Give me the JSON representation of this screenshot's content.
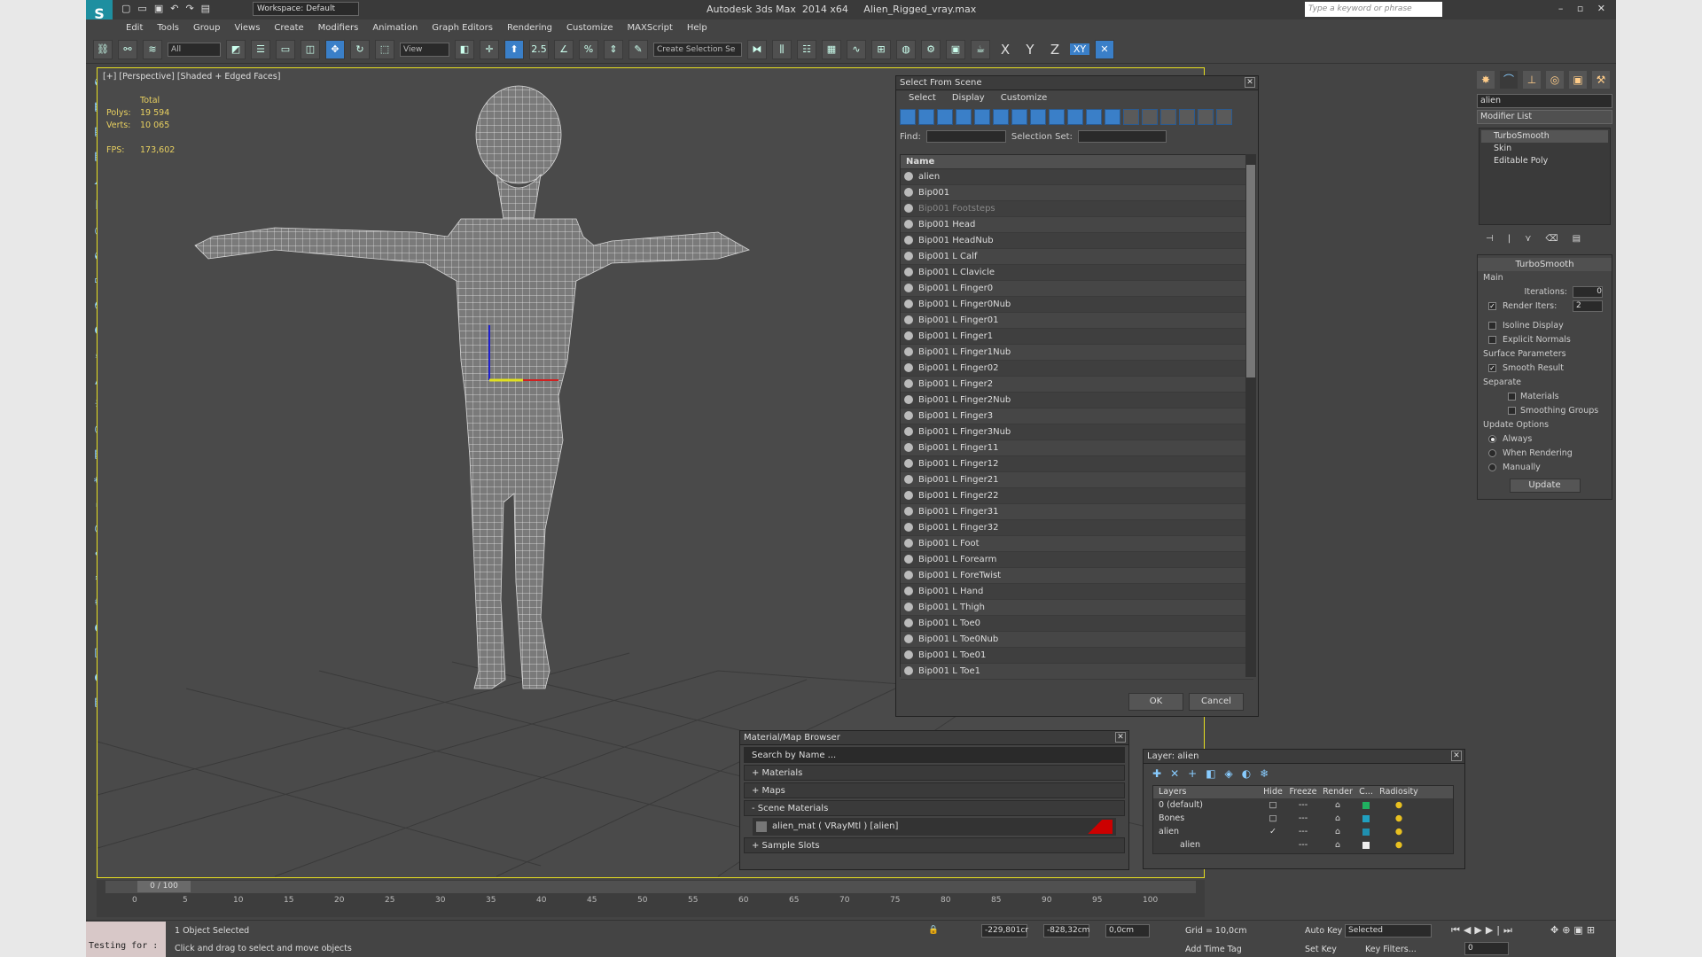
{
  "titlebar": {
    "app_title": "Autodesk 3ds Max  2014 x64     Alien_Rigged_vray.max",
    "workspace": "Workspace: Default",
    "keyword_placeholder": "Type a keyword or phrase"
  },
  "menu": [
    "Edit",
    "Tools",
    "Group",
    "Views",
    "Create",
    "Modifiers",
    "Animation",
    "Graph Editors",
    "Rendering",
    "Customize",
    "MAXScript",
    "Help"
  ],
  "toolbar": {
    "filter": "All",
    "view": "View",
    "snap_angle": "2.5",
    "selection_set": "Create Selection Se",
    "axes": [
      "X",
      "Y",
      "Z",
      "XY"
    ]
  },
  "viewport": {
    "label": "[+] [Perspective] [Shaded + Edged Faces]",
    "stats_total": "Total",
    "polys_label": "Polys:",
    "polys_value": "19 594",
    "verts_label": "Verts:",
    "verts_value": "10 065",
    "fps_label": "FPS:",
    "fps_value": "173,602"
  },
  "select_from_scene": {
    "title": "Select From Scene",
    "menu": [
      "Select",
      "Display",
      "Customize"
    ],
    "find_label": "Find:",
    "selection_set_label": "Selection Set:",
    "column_name": "Name",
    "items": [
      "alien",
      "Bip001",
      "Bip001 Footsteps",
      "Bip001 Head",
      "Bip001 HeadNub",
      "Bip001 L Calf",
      "Bip001 L Clavicle",
      "Bip001 L Finger0",
      "Bip001 L Finger0Nub",
      "Bip001 L Finger01",
      "Bip001 L Finger1",
      "Bip001 L Finger1Nub",
      "Bip001 L Finger02",
      "Bip001 L Finger2",
      "Bip001 L Finger2Nub",
      "Bip001 L Finger3",
      "Bip001 L Finger3Nub",
      "Bip001 L Finger11",
      "Bip001 L Finger12",
      "Bip001 L Finger21",
      "Bip001 L Finger22",
      "Bip001 L Finger31",
      "Bip001 L Finger32",
      "Bip001 L Foot",
      "Bip001 L Forearm",
      "Bip001 L ForeTwist",
      "Bip001 L Hand",
      "Bip001 L Thigh",
      "Bip001 L Toe0",
      "Bip001 L Toe0Nub",
      "Bip001 L Toe01",
      "Bip001 L Toe1"
    ],
    "ok": "OK",
    "cancel": "Cancel"
  },
  "material_browser": {
    "title": "Material/Map Browser",
    "search_placeholder": "Search by Name ...",
    "materials": "+ Materials",
    "maps": "+ Maps",
    "scene_materials": "- Scene Materials",
    "material_item": "alien_mat  ( VRayMtl )  [alien]",
    "sample_slots": "+ Sample Slots"
  },
  "layer_panel": {
    "title": "Layer: alien",
    "headers": [
      "Layers",
      "Hide",
      "Freeze",
      "Render",
      "C...",
      "Radiosity"
    ],
    "rows": [
      "0 (default)",
      "Bones",
      "alien",
      "alien"
    ]
  },
  "command_panel": {
    "object_name": "alien",
    "modifier_list": "Modifier List",
    "stack": [
      "TurboSmooth",
      "Skin",
      "Editable Poly"
    ],
    "turbosmooth_title": "TurboSmooth",
    "main_label": "Main",
    "iterations_label": "Iterations:",
    "iterations_value": "0",
    "render_iters_label": "Render Iters:",
    "render_iters_value": "2",
    "isoline": "Isoline Display",
    "explicit_normals": "Explicit Normals",
    "surface_params": "Surface Parameters",
    "smooth_result": "Smooth Result",
    "separate": "Separate",
    "materials": "Materials",
    "smoothing_groups": "Smoothing Groups",
    "update_options": "Update Options",
    "always": "Always",
    "when_rendering": "When Rendering",
    "manually": "Manually",
    "update_btn": "Update"
  },
  "timeline": {
    "frame": "0 / 100",
    "ticks": [
      "0",
      "5",
      "10",
      "15",
      "20",
      "25",
      "30",
      "35",
      "40",
      "45",
      "50",
      "55",
      "60",
      "65",
      "70",
      "75",
      "80",
      "85",
      "90",
      "95",
      "100"
    ]
  },
  "status": {
    "maxscript": "Testing for :",
    "selected": "1 Object Selected",
    "prompt": "Click and drag to select and move objects",
    "x": "-229,801cr",
    "y": "-828,32cm",
    "z": "0,0cm",
    "grid": "Grid = 10,0cm",
    "add_time_tag": "Add Time Tag",
    "auto_key": "Auto Key",
    "selected_dd": "Selected",
    "set_key": "Set Key",
    "key_filters": "Key Filters...",
    "frame_box": "0"
  }
}
